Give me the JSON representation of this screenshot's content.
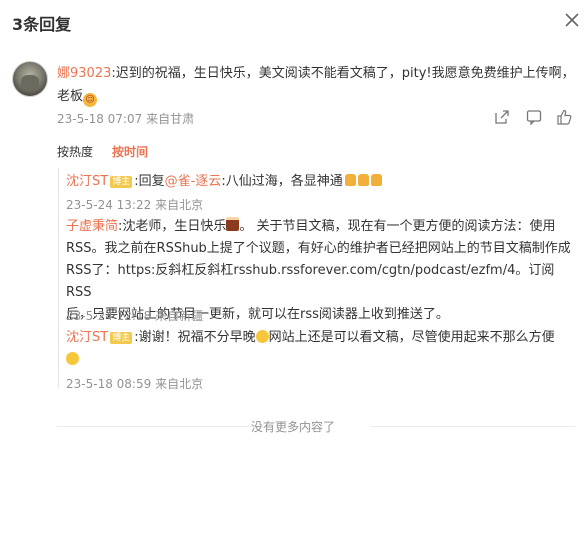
{
  "header": {
    "title": "3条回复"
  },
  "comment": {
    "username": "娜93023",
    "text_1": ":迟到的祝福，生日快乐，美文阅读不能看文稿了，pity!我愿意免费维护上传啊，",
    "text_2": "老板",
    "time": "23-5-18 07:07",
    "location": "来自甘肃"
  },
  "sort": {
    "hot": "按热度",
    "time": "按时间"
  },
  "replies": [
    {
      "username": "沈汀ST",
      "badge": "博主",
      "text_prefix": ":回复",
      "mention": "@雀-逐云",
      "text": ":八仙过海，各显神通",
      "time": "23-5-24 13:22",
      "location": "来自北京"
    },
    {
      "username": "子虚秉简",
      "text_1": ":沈老师，生日快乐",
      "text_2": "。 关于节目文稿，现在有一个更方便的阅读方法：使用",
      "line_2": "RSS。我之前在RSShub上提了个议题，有好心的维护者已经把网站上的节目文稿制作成",
      "line_3": "RSS了：https:反斜杠反斜杠rsshub.rssforever.com/cgtn/podcast/ezfm/4。订阅RSS",
      "line_4": "后，只要网站上的节目一更新，就可以在rss阅读器上收到推送了。",
      "time": "23-5-24 12:18",
      "location": "来自新疆"
    },
    {
      "username": "沈汀ST",
      "badge": "博主",
      "text_1": ":谢谢！祝福不分早晚",
      "text_2": "网站上还是可以看文稿，尽管使用起来不那么方便",
      "time": "23-5-18 08:59",
      "location": "来自北京"
    }
  ],
  "footer": {
    "no_more": "没有更多内容了"
  },
  "icons": {
    "close": "close-icon",
    "share": "share-icon",
    "comment": "comment-icon",
    "like": "like-icon"
  },
  "colors": {
    "accent": "#eb7350",
    "meta": "#939393"
  }
}
